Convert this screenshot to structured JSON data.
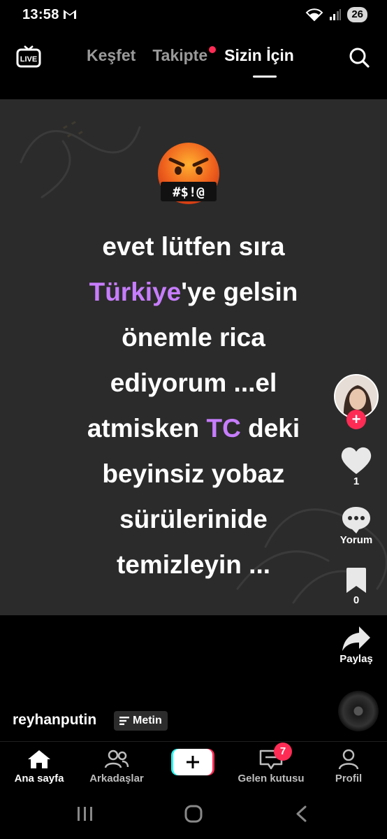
{
  "status_bar": {
    "time": "13:58",
    "battery": "26",
    "icons": [
      "gmail-icon",
      "wifi-icon",
      "signal-icon",
      "battery-icon"
    ]
  },
  "top_nav": {
    "live_label": "LIVE",
    "tabs": [
      {
        "label": "Keşfet",
        "active": false
      },
      {
        "label": "Takipte",
        "active": false,
        "dot": true
      },
      {
        "label": "Sizin İçin",
        "active": true
      }
    ]
  },
  "video": {
    "emoji": "🤬",
    "lines": [
      {
        "parts": [
          {
            "text": "evet lütfen sıra"
          }
        ]
      },
      {
        "parts": [
          {
            "text": "Türkiye",
            "highlight": true
          },
          {
            "text": "'ye gelsin"
          }
        ]
      },
      {
        "parts": [
          {
            "text": "önemle rica"
          }
        ]
      },
      {
        "parts": [
          {
            "text": "ediyorum ...el"
          }
        ]
      },
      {
        "parts": [
          {
            "text": "atmisken "
          },
          {
            "text": "TC",
            "highlight": true
          },
          {
            "text": " deki"
          }
        ]
      },
      {
        "parts": [
          {
            "text": "beyinsiz yobaz"
          }
        ]
      },
      {
        "parts": [
          {
            "text": "sürülerinide"
          }
        ]
      },
      {
        "parts": [
          {
            "text": "temizleyin ..."
          }
        ]
      }
    ],
    "highlight_color": "#c77dff"
  },
  "rail": {
    "like_count": "1",
    "comment_label": "Yorum",
    "bookmark_count": "0",
    "share_label": "Paylaş"
  },
  "caption": {
    "author": "reyhanputin",
    "chip_label": "Metin"
  },
  "bottom_nav": {
    "items": [
      {
        "label": "Ana sayfa",
        "active": true
      },
      {
        "label": "Arkadaşlar",
        "active": false
      },
      {
        "label": "Gelen kutusu",
        "active": false,
        "badge": "7"
      },
      {
        "label": "Profil",
        "active": false
      }
    ]
  },
  "colors": {
    "accent": "#fe2c55",
    "highlight": "#c77dff",
    "background": "#000000",
    "video_bg": "#2b2b2b"
  }
}
